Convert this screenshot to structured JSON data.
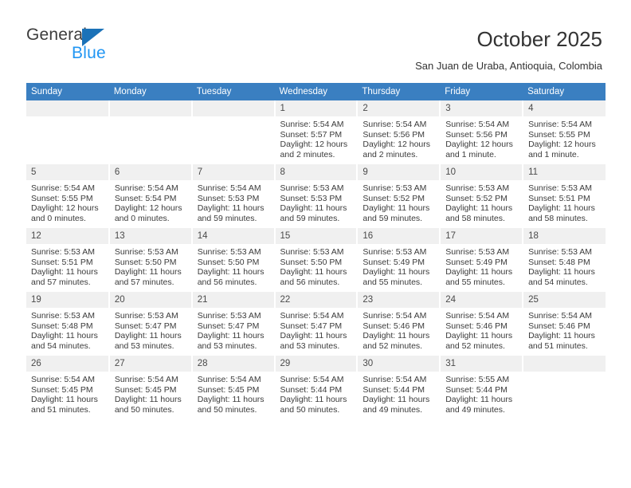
{
  "brand": {
    "name_part1": "General",
    "name_part2": "Blue",
    "logo_icon": "triangle-flag-icon",
    "accent_color": "#1b72b8",
    "secondary_color": "#2196f3"
  },
  "header": {
    "title": "October 2025",
    "subtitle": "San Juan de Uraba, Antioquia, Colombia"
  },
  "calendar": {
    "header_bg": "#3a7fc1",
    "daynum_bg": "#f0f0f0",
    "weekdays": [
      "Sunday",
      "Monday",
      "Tuesday",
      "Wednesday",
      "Thursday",
      "Friday",
      "Saturday"
    ],
    "weeks": [
      [
        {
          "day": "",
          "lines": []
        },
        {
          "day": "",
          "lines": []
        },
        {
          "day": "",
          "lines": []
        },
        {
          "day": "1",
          "lines": [
            "Sunrise: 5:54 AM",
            "Sunset: 5:57 PM",
            "Daylight: 12 hours",
            "and 2 minutes."
          ]
        },
        {
          "day": "2",
          "lines": [
            "Sunrise: 5:54 AM",
            "Sunset: 5:56 PM",
            "Daylight: 12 hours",
            "and 2 minutes."
          ]
        },
        {
          "day": "3",
          "lines": [
            "Sunrise: 5:54 AM",
            "Sunset: 5:56 PM",
            "Daylight: 12 hours",
            "and 1 minute."
          ]
        },
        {
          "day": "4",
          "lines": [
            "Sunrise: 5:54 AM",
            "Sunset: 5:55 PM",
            "Daylight: 12 hours",
            "and 1 minute."
          ]
        }
      ],
      [
        {
          "day": "5",
          "lines": [
            "Sunrise: 5:54 AM",
            "Sunset: 5:55 PM",
            "Daylight: 12 hours",
            "and 0 minutes."
          ]
        },
        {
          "day": "6",
          "lines": [
            "Sunrise: 5:54 AM",
            "Sunset: 5:54 PM",
            "Daylight: 12 hours",
            "and 0 minutes."
          ]
        },
        {
          "day": "7",
          "lines": [
            "Sunrise: 5:54 AM",
            "Sunset: 5:53 PM",
            "Daylight: 11 hours",
            "and 59 minutes."
          ]
        },
        {
          "day": "8",
          "lines": [
            "Sunrise: 5:53 AM",
            "Sunset: 5:53 PM",
            "Daylight: 11 hours",
            "and 59 minutes."
          ]
        },
        {
          "day": "9",
          "lines": [
            "Sunrise: 5:53 AM",
            "Sunset: 5:52 PM",
            "Daylight: 11 hours",
            "and 59 minutes."
          ]
        },
        {
          "day": "10",
          "lines": [
            "Sunrise: 5:53 AM",
            "Sunset: 5:52 PM",
            "Daylight: 11 hours",
            "and 58 minutes."
          ]
        },
        {
          "day": "11",
          "lines": [
            "Sunrise: 5:53 AM",
            "Sunset: 5:51 PM",
            "Daylight: 11 hours",
            "and 58 minutes."
          ]
        }
      ],
      [
        {
          "day": "12",
          "lines": [
            "Sunrise: 5:53 AM",
            "Sunset: 5:51 PM",
            "Daylight: 11 hours",
            "and 57 minutes."
          ]
        },
        {
          "day": "13",
          "lines": [
            "Sunrise: 5:53 AM",
            "Sunset: 5:50 PM",
            "Daylight: 11 hours",
            "and 57 minutes."
          ]
        },
        {
          "day": "14",
          "lines": [
            "Sunrise: 5:53 AM",
            "Sunset: 5:50 PM",
            "Daylight: 11 hours",
            "and 56 minutes."
          ]
        },
        {
          "day": "15",
          "lines": [
            "Sunrise: 5:53 AM",
            "Sunset: 5:50 PM",
            "Daylight: 11 hours",
            "and 56 minutes."
          ]
        },
        {
          "day": "16",
          "lines": [
            "Sunrise: 5:53 AM",
            "Sunset: 5:49 PM",
            "Daylight: 11 hours",
            "and 55 minutes."
          ]
        },
        {
          "day": "17",
          "lines": [
            "Sunrise: 5:53 AM",
            "Sunset: 5:49 PM",
            "Daylight: 11 hours",
            "and 55 minutes."
          ]
        },
        {
          "day": "18",
          "lines": [
            "Sunrise: 5:53 AM",
            "Sunset: 5:48 PM",
            "Daylight: 11 hours",
            "and 54 minutes."
          ]
        }
      ],
      [
        {
          "day": "19",
          "lines": [
            "Sunrise: 5:53 AM",
            "Sunset: 5:48 PM",
            "Daylight: 11 hours",
            "and 54 minutes."
          ]
        },
        {
          "day": "20",
          "lines": [
            "Sunrise: 5:53 AM",
            "Sunset: 5:47 PM",
            "Daylight: 11 hours",
            "and 53 minutes."
          ]
        },
        {
          "day": "21",
          "lines": [
            "Sunrise: 5:53 AM",
            "Sunset: 5:47 PM",
            "Daylight: 11 hours",
            "and 53 minutes."
          ]
        },
        {
          "day": "22",
          "lines": [
            "Sunrise: 5:54 AM",
            "Sunset: 5:47 PM",
            "Daylight: 11 hours",
            "and 53 minutes."
          ]
        },
        {
          "day": "23",
          "lines": [
            "Sunrise: 5:54 AM",
            "Sunset: 5:46 PM",
            "Daylight: 11 hours",
            "and 52 minutes."
          ]
        },
        {
          "day": "24",
          "lines": [
            "Sunrise: 5:54 AM",
            "Sunset: 5:46 PM",
            "Daylight: 11 hours",
            "and 52 minutes."
          ]
        },
        {
          "day": "25",
          "lines": [
            "Sunrise: 5:54 AM",
            "Sunset: 5:46 PM",
            "Daylight: 11 hours",
            "and 51 minutes."
          ]
        }
      ],
      [
        {
          "day": "26",
          "lines": [
            "Sunrise: 5:54 AM",
            "Sunset: 5:45 PM",
            "Daylight: 11 hours",
            "and 51 minutes."
          ]
        },
        {
          "day": "27",
          "lines": [
            "Sunrise: 5:54 AM",
            "Sunset: 5:45 PM",
            "Daylight: 11 hours",
            "and 50 minutes."
          ]
        },
        {
          "day": "28",
          "lines": [
            "Sunrise: 5:54 AM",
            "Sunset: 5:45 PM",
            "Daylight: 11 hours",
            "and 50 minutes."
          ]
        },
        {
          "day": "29",
          "lines": [
            "Sunrise: 5:54 AM",
            "Sunset: 5:44 PM",
            "Daylight: 11 hours",
            "and 50 minutes."
          ]
        },
        {
          "day": "30",
          "lines": [
            "Sunrise: 5:54 AM",
            "Sunset: 5:44 PM",
            "Daylight: 11 hours",
            "and 49 minutes."
          ]
        },
        {
          "day": "31",
          "lines": [
            "Sunrise: 5:55 AM",
            "Sunset: 5:44 PM",
            "Daylight: 11 hours",
            "and 49 minutes."
          ]
        },
        {
          "day": "",
          "lines": []
        }
      ]
    ]
  }
}
